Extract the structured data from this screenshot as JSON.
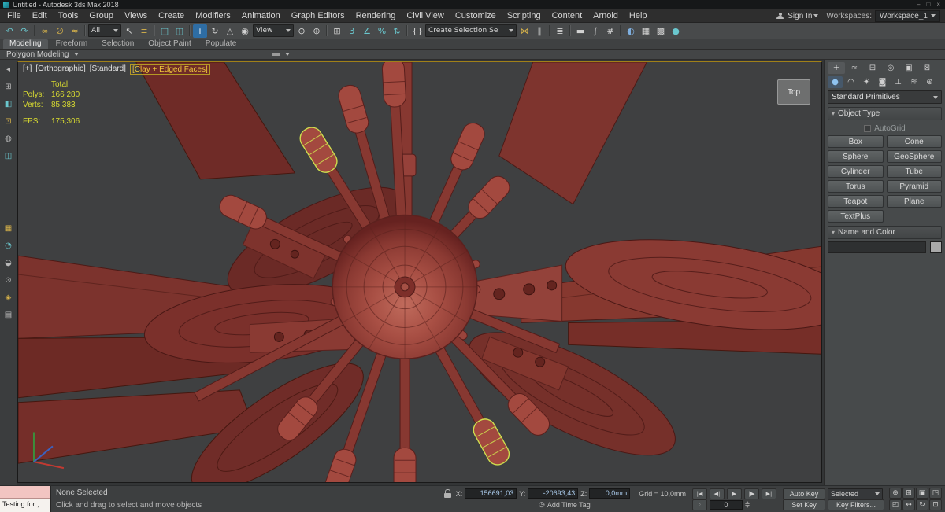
{
  "window": {
    "title": "Untitled - Autodesk 3ds Max 2018",
    "minimize_glyph": "–",
    "maximize_glyph": "□",
    "close_glyph": "×"
  },
  "menubar": {
    "items": [
      "File",
      "Edit",
      "Tools",
      "Group",
      "Views",
      "Create",
      "Modifiers",
      "Animation",
      "Graph Editors",
      "Rendering",
      "Civil View",
      "Customize",
      "Scripting",
      "Content",
      "Arnold",
      "Help"
    ],
    "sign_in": "Sign In",
    "workspaces_label": "Workspaces:",
    "workspace_value": "Workspace_1"
  },
  "toolbar": {
    "selection_filter_value": "All",
    "coord_system_value": "View",
    "named_sets_value": "Create Selection Se",
    "icons": [
      {
        "name": "undo",
        "glyph": "↶"
      },
      {
        "name": "redo",
        "glyph": "↷"
      },
      {
        "name": "select-and-link",
        "glyph": "∞"
      },
      {
        "name": "unlink-selection",
        "glyph": "∅"
      },
      {
        "name": "bind-to-space-warp",
        "glyph": "≈"
      },
      {
        "name": "select-object",
        "glyph": "↖"
      },
      {
        "name": "select-by-name",
        "glyph": "≡"
      },
      {
        "name": "rectangular-selection-region",
        "glyph": "□"
      },
      {
        "name": "window-crossing",
        "glyph": "◫"
      },
      {
        "name": "select-and-move",
        "glyph": "+"
      },
      {
        "name": "select-and-rotate",
        "glyph": "↻"
      },
      {
        "name": "select-and-scale",
        "glyph": "△"
      },
      {
        "name": "select-and-place",
        "glyph": "◉"
      },
      {
        "name": "use-pivot-point-center",
        "glyph": "⊙"
      },
      {
        "name": "select-and-manipulate",
        "glyph": "⊕"
      },
      {
        "name": "keyboard-shortcut-override",
        "glyph": "⊞"
      },
      {
        "name": "snaps-toggle",
        "glyph": "3"
      },
      {
        "name": "angle-snap",
        "glyph": "∠"
      },
      {
        "name": "percent-snap",
        "glyph": "%"
      },
      {
        "name": "spinner-snap",
        "glyph": "⇅"
      },
      {
        "name": "edit-named-selection-sets",
        "glyph": "{}"
      },
      {
        "name": "mirror",
        "glyph": "⋈"
      },
      {
        "name": "align",
        "glyph": "∥"
      },
      {
        "name": "toggle-layer-explorer",
        "glyph": "≣"
      },
      {
        "name": "toggle-ribbon",
        "glyph": "▬"
      },
      {
        "name": "curve-editor",
        "glyph": "∫"
      },
      {
        "name": "schematic-view",
        "glyph": "#"
      },
      {
        "name": "material-editor",
        "glyph": "◐"
      },
      {
        "name": "render-setup",
        "glyph": "▦"
      },
      {
        "name": "rendered-frame-window",
        "glyph": "▩"
      },
      {
        "name": "render-production",
        "glyph": "●"
      }
    ]
  },
  "ribbon": {
    "tabs": [
      "Modeling",
      "Freeform",
      "Selection",
      "Object Paint",
      "Populate"
    ],
    "subtab": "Polygon Modeling"
  },
  "left_toolbar": {
    "icons": [
      "◂",
      "⊞",
      "◧",
      "⊡",
      "◍",
      "◫",
      "▦",
      "◔",
      "◒",
      "⊙",
      "◈",
      "▤"
    ]
  },
  "viewport": {
    "labels": {
      "menu": "[+]",
      "view": "[Orthographic]",
      "style": "[Standard]",
      "shading": "[Clay + Edged Faces]"
    },
    "stats": {
      "total_label": "Total",
      "polys_label": "Polys:",
      "polys_value": "166 280",
      "verts_label": "Verts:",
      "verts_value": "85 383",
      "fps_label": "FPS:",
      "fps_value": "175,306"
    },
    "viewcube_label": "Top"
  },
  "command_panel": {
    "tabs": [
      {
        "name": "create",
        "glyph": "+"
      },
      {
        "name": "modify",
        "glyph": "≈"
      },
      {
        "name": "hierarchy",
        "glyph": "⊟"
      },
      {
        "name": "motion",
        "glyph": "◎"
      },
      {
        "name": "display",
        "glyph": "▣"
      },
      {
        "name": "utilities",
        "glyph": "⊠"
      }
    ],
    "categories": [
      {
        "name": "geometry",
        "glyph": "●"
      },
      {
        "name": "shapes",
        "glyph": "◠"
      },
      {
        "name": "lights",
        "glyph": "☀"
      },
      {
        "name": "cameras",
        "glyph": "◙"
      },
      {
        "name": "helpers",
        "glyph": "⊥"
      },
      {
        "name": "space-warps",
        "glyph": "≋"
      },
      {
        "name": "systems",
        "glyph": "⊛"
      }
    ],
    "primitive_dropdown_value": "Standard Primitives",
    "object_type_title": "Object Type",
    "autogrid_label": "AutoGrid",
    "object_buttons": [
      "Box",
      "Cone",
      "Sphere",
      "GeoSphere",
      "Cylinder",
      "Tube",
      "Torus",
      "Pyramid",
      "Teapot",
      "Plane",
      "TextPlus"
    ],
    "name_color_title": "Name and Color",
    "collapse_glyph": "▾"
  },
  "status_bar": {
    "macro_recorder_text": "",
    "listener_text": "Testing for ,",
    "selection_status": "None Selected",
    "prompt": "Click and drag to select and move objects",
    "coords": {
      "x_label": "X:",
      "x": "156691,03",
      "y_label": "Y:",
      "y": "-20693,43",
      "z_label": "Z:",
      "z": "0,0mm"
    },
    "grid": "Grid = 10,0mm",
    "time_tag_icon": "◷",
    "time_tag": "Add Time Tag",
    "playback": {
      "start": "|◀",
      "prev": "◀|",
      "play": "▶",
      "next": "|▶",
      "end": "▶|"
    },
    "key_mode_glyph": "◦",
    "frame": "0",
    "auto_key": "Auto Key",
    "set_key": "Set Key",
    "key_mode": "Selected",
    "key_filters": "Key Filters...",
    "nav": [
      {
        "name": "zoom",
        "glyph": "⊕"
      },
      {
        "name": "zoom-all",
        "glyph": "⊞"
      },
      {
        "name": "zoom-extents",
        "glyph": "▣"
      },
      {
        "name": "zoom-extents-all",
        "glyph": "◳"
      },
      {
        "name": "zoom-region",
        "glyph": "◰"
      },
      {
        "name": "pan",
        "glyph": "↔"
      },
      {
        "name": "orbit",
        "glyph": "↻"
      },
      {
        "name": "maximize-viewport",
        "glyph": "⊡"
      }
    ]
  }
}
